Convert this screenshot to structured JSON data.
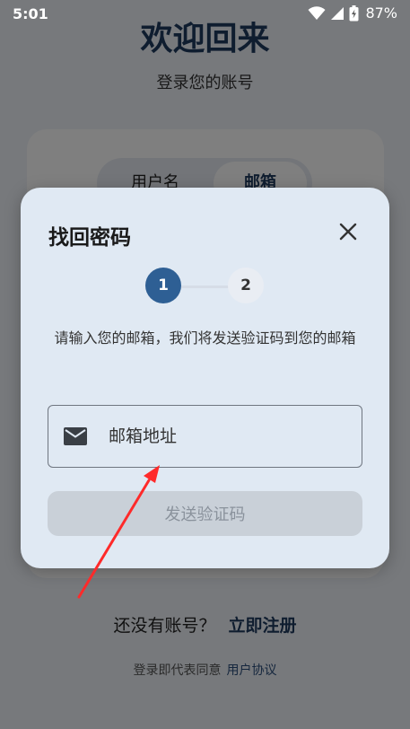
{
  "status_bar": {
    "time": "5:01",
    "battery": "87%"
  },
  "background": {
    "title": "欢迎回来",
    "subtitle": "登录您的账号",
    "tabs": [
      {
        "label": "用户名"
      },
      {
        "label": "邮箱"
      }
    ],
    "signup_prompt": "还没有账号？",
    "signup_link": "立即注册",
    "terms_prefix": "登录即代表同意",
    "terms_link": "用户协议"
  },
  "dialog": {
    "title": "找回密码",
    "steps": [
      "1",
      "2"
    ],
    "active_step": 1,
    "description": "请输入您的邮箱，我们将发送验证码到您的邮箱",
    "email_placeholder": "邮箱地址",
    "email_value": "",
    "send_button": "发送验证码"
  },
  "colors": {
    "primary": "#2e5f94",
    "dialog_bg": "#e0e9f3",
    "annotation": "#ff2a2a"
  }
}
